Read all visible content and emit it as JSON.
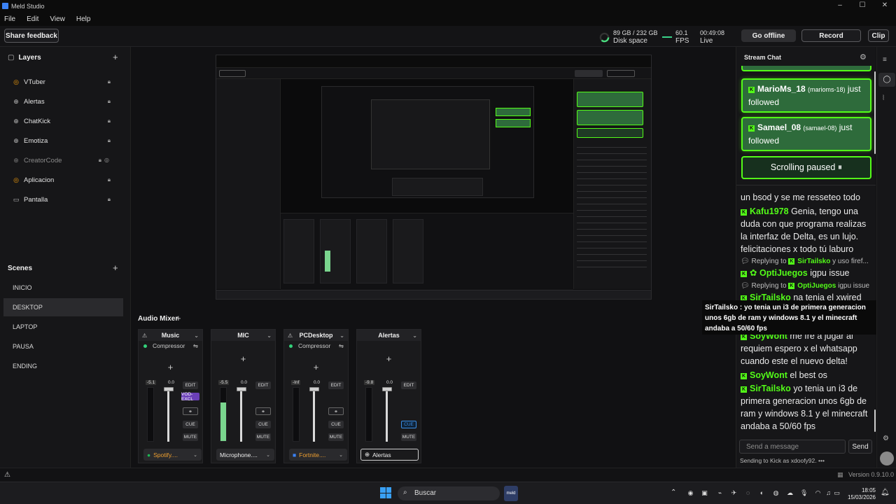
{
  "window": {
    "title": "Meld Studio",
    "controls": [
      "–",
      "☐",
      "✕"
    ]
  },
  "menu": [
    "File",
    "Edit",
    "View",
    "Help"
  ],
  "toolbar": {
    "share_feedback": "Share feedback",
    "disk": "89 GB / 232 GB",
    "disk_label": "Disk space",
    "fps_value": "60.1",
    "fps_label": "FPS",
    "live_time": "00:49:08",
    "live_label": "Live",
    "go_offline": "Go offline",
    "record": "Record",
    "clip": "Clip"
  },
  "layers": {
    "title": "Layers",
    "items": [
      {
        "name": "VTuber",
        "icon": "vtuber-icon"
      },
      {
        "name": "Alertas",
        "icon": "browser-icon"
      },
      {
        "name": "ChatKick",
        "icon": "browser-icon"
      },
      {
        "name": "Emotiza",
        "icon": "browser-icon"
      },
      {
        "name": "CreatorCode",
        "icon": "browser-icon"
      },
      {
        "name": "Aplicacion",
        "icon": "vtuber-icon"
      },
      {
        "name": "Pantalla",
        "icon": "monitor-icon"
      }
    ]
  },
  "scenes": {
    "title": "Scenes",
    "items": [
      "INICIO",
      "DESKTOP",
      "LAPTOP",
      "PAUSA",
      "ENDING"
    ],
    "active": "DESKTOP"
  },
  "mixer": {
    "title": "Audio Mixer",
    "channels": [
      {
        "name": "Music",
        "filter": "Compressor",
        "db": "-5.1",
        "gain": "0.0",
        "source": "Spotify....",
        "level": 0
      },
      {
        "name": "MIC",
        "filter": "",
        "db": "-5.5",
        "gain": "0.0",
        "source": "Microphone....",
        "level": 0.72
      },
      {
        "name": "PCDesktop",
        "filter": "Compressor",
        "db": "-Inf",
        "gain": "0.0",
        "source": "Fortnite....",
        "level": 0
      },
      {
        "name": "Alertas",
        "filter": "",
        "db": "-9.8",
        "gain": "0.0",
        "source": "Alertas",
        "level": 0
      }
    ],
    "btn_edit": "EDIT",
    "btn_cue": "CUE",
    "btn_mute": "MUTE",
    "btn_vod": "VOD-EXCL"
  },
  "chat": {
    "title": "Stream Chat",
    "follows": [
      {
        "user": "MarioMs_18",
        "handle": "(marioms-18)",
        "text": "just followed"
      },
      {
        "user": "Samael_08",
        "handle": "(samael-08)",
        "text": "just followed"
      }
    ],
    "scrolling_paused": "Scrolling paused ⏸",
    "messages": [
      {
        "user": "",
        "text": "un bsod y se me resseteo todo"
      },
      {
        "user": "Kafu1978",
        "text": "Genia, tengo una duda con que programa realizas la interfaz de Delta, es un lujo. felicitaciones x todo tú laburo"
      },
      {
        "reply_to": "SirTailsko",
        "reply_text": "y uso firef...",
        "user": "OptiJuegos",
        "text": "igpu issue"
      },
      {
        "reply_to": "OptiJuegos",
        "reply_text": "igpu issue",
        "user": "SirTailsko",
        "text": "na tenia el xwired"
      },
      {
        "user": "SoyWont",
        "text": "me fre a jugar al requiem espero x el whatsapp cuando este el nuevo delta!"
      },
      {
        "user": "SoyWont",
        "text": "el best os"
      },
      {
        "user": "SirTailsko",
        "text": "yo tenia un i3 de primera generacion unos 6gb de ram y windows 8.1 y el minecraft andaba a 50/60 fps"
      }
    ],
    "replying_to": "Replying to",
    "tooltip": "SirTailsko : yo tenia un i3 de primera generacion unos 6gb de ram y windows 8.1 y el minecraft andaba a 50/60 fps",
    "input_placeholder": "Send a message",
    "send": "Send",
    "sending_as": "Sending to Kick as xdoofy92."
  },
  "status": {
    "version": "Version 0.9.10.0"
  },
  "taskbar": {
    "search_placeholder": "Buscar",
    "time": "18:05",
    "date": "15/03/2026"
  },
  "colors": {
    "kick_green": "#53fc18",
    "follow_bg": "#2e6b3b",
    "meter_green": "#7ad58e",
    "accent_blue": "#3a8ee6"
  }
}
